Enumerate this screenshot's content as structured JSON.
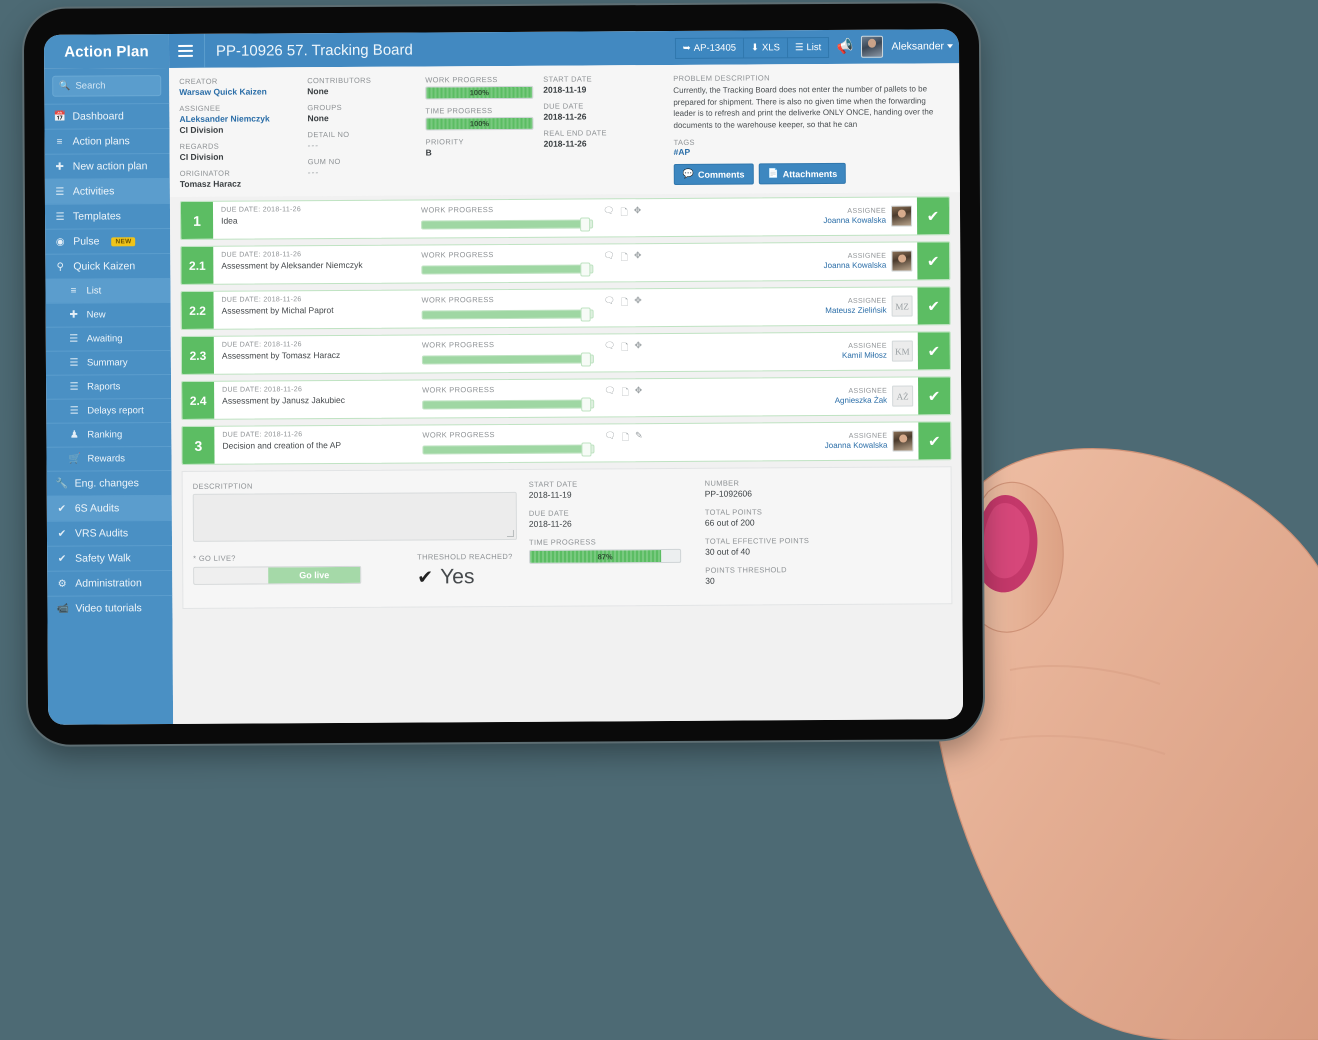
{
  "app": {
    "brand": "Action Plan",
    "page_title": "PP-10926 57. Tracking Board",
    "hamburger_icon": "hamburger-menu-icon"
  },
  "topbar": {
    "buttons": [
      {
        "label": "AP-13405",
        "icon": "external-link-icon"
      },
      {
        "label": "XLS",
        "icon": "download-icon"
      },
      {
        "label": "List",
        "icon": "list-icon"
      }
    ],
    "megaphone_icon": "megaphone-icon",
    "user": "Aleksander"
  },
  "sidebar": {
    "search_placeholder": "Search",
    "search_value": "",
    "items": [
      {
        "label": "Dashboard",
        "icon": "calendar-icon",
        "active": false,
        "sub": false
      },
      {
        "label": "Action plans",
        "icon": "board-icon",
        "active": false,
        "sub": false
      },
      {
        "label": "New action plan",
        "icon": "plus-icon",
        "active": false,
        "sub": false
      },
      {
        "label": "Activities",
        "icon": "sliders-icon",
        "active": true,
        "sub": false
      },
      {
        "label": "Templates",
        "icon": "list-icon",
        "active": false,
        "sub": false
      },
      {
        "label": "Pulse",
        "icon": "circle-icon",
        "active": false,
        "sub": false,
        "badge": "NEW"
      },
      {
        "label": "Quick Kaizen",
        "icon": "bulb-icon",
        "active": false,
        "sub": false
      },
      {
        "label": "List",
        "icon": "board-icon",
        "active": true,
        "sub": true
      },
      {
        "label": "New",
        "icon": "plus-icon",
        "active": false,
        "sub": true
      },
      {
        "label": "Awaiting",
        "icon": "list-icon",
        "active": false,
        "sub": true
      },
      {
        "label": "Summary",
        "icon": "list-icon",
        "active": false,
        "sub": true
      },
      {
        "label": "Raports",
        "icon": "list-icon",
        "active": false,
        "sub": true
      },
      {
        "label": "Delays report",
        "icon": "list-icon",
        "active": false,
        "sub": true
      },
      {
        "label": "Ranking",
        "icon": "trophy-icon",
        "active": false,
        "sub": true
      },
      {
        "label": "Rewards",
        "icon": "cart-icon",
        "active": false,
        "sub": true
      },
      {
        "label": "Eng. changes",
        "icon": "wrench-icon",
        "active": false,
        "sub": false
      },
      {
        "label": "6S Audits",
        "icon": "check-icon",
        "active": true,
        "sub": false
      },
      {
        "label": "VRS Audits",
        "icon": "check-icon",
        "active": false,
        "sub": false
      },
      {
        "label": "Safety Walk",
        "icon": "check-icon",
        "active": false,
        "sub": false
      },
      {
        "label": "Administration",
        "icon": "gear-icon",
        "active": false,
        "sub": false
      },
      {
        "label": "Video tutorials",
        "icon": "video-icon",
        "active": false,
        "sub": false
      }
    ]
  },
  "info": {
    "col1": [
      {
        "label": "CREATOR",
        "value": "Warsaw Quick Kaizen",
        "style": "link"
      },
      {
        "label": "ASSIGNEE",
        "value": "ALeksander Niemczyk",
        "style": "link",
        "sub": "CI Division"
      },
      {
        "label": "REGARDS",
        "value": "CI Division",
        "style": "bold"
      },
      {
        "label": "ORIGINATOR",
        "value": "Tomasz Haracz",
        "style": "bold"
      }
    ],
    "col2": [
      {
        "label": "CONTRIBUTORS",
        "value": "None",
        "style": "bold"
      },
      {
        "label": "GROUPS",
        "value": "None",
        "style": "bold"
      },
      {
        "label": "DETAIL NO",
        "value": "---",
        "style": "muted"
      },
      {
        "label": "GUM NO",
        "value": "---",
        "style": "muted"
      }
    ],
    "col3": [
      {
        "label": "WORK PROGRESS",
        "type": "bar",
        "value": 100,
        "text": "100%"
      },
      {
        "label": "TIME PROGRESS",
        "type": "bar",
        "value": 100,
        "text": "100%"
      },
      {
        "label": "PRIORITY",
        "type": "text",
        "value": "B"
      }
    ],
    "col4": [
      {
        "label": "START DATE",
        "value": "2018-11-19"
      },
      {
        "label": "DUE DATE",
        "value": "2018-11-26"
      },
      {
        "label": "REAL END DATE",
        "value": "2018-11-26"
      }
    ],
    "problem": {
      "label": "PROBLEM DESCRIPTION",
      "text": "Currently, the Tracking Board does not enter the number of pallets to be prepared for shipment. There is also no given time when the forwarding leader is to refresh and print the deliverke ONLY ONCE, handing over the documents to the warehouse keeper, so that he can",
      "tags_label": "TAGS",
      "tags": "#AP",
      "buttons": [
        {
          "label": "Comments",
          "icon": "comment-icon"
        },
        {
          "label": "Attachments",
          "icon": "file-icon"
        }
      ]
    }
  },
  "tasks": {
    "due_label": "DUE DATE:",
    "progress_label": "WORK PROGRESS",
    "assignee_label": "ASSIGNEE",
    "rows": [
      {
        "num": "1",
        "due": "2018-11-26",
        "name": "Idea",
        "progress": 96,
        "assignee": "Joanna Kowalska",
        "initials": "JK",
        "photo": true,
        "icons": [
          "comment-icon",
          "file-icon",
          "expand-icon"
        ]
      },
      {
        "num": "2.1",
        "due": "2018-11-26",
        "name": "Assessment by Aleksander Niemczyk",
        "progress": 96,
        "assignee": "Joanna Kowalska",
        "initials": "JK",
        "photo": true,
        "icons": [
          "comment-icon",
          "file-icon",
          "expand-icon"
        ]
      },
      {
        "num": "2.2",
        "due": "2018-11-26",
        "name": "Assessment by Michal Paprot",
        "progress": 96,
        "assignee": "Mateusz Zielińsik",
        "initials": "MZ",
        "photo": false,
        "icons": [
          "comment-icon",
          "file-icon",
          "expand-icon"
        ]
      },
      {
        "num": "2.3",
        "due": "2018-11-26",
        "name": "Assessment by Tomasz Haracz",
        "progress": 96,
        "assignee": "Kamil Miłosz",
        "initials": "KM",
        "photo": false,
        "icons": [
          "comment-icon",
          "file-icon",
          "expand-icon"
        ]
      },
      {
        "num": "2.4",
        "due": "2018-11-26",
        "name": "Assessment by Janusz Jakubiec",
        "progress": 96,
        "assignee": "Agnieszka Żak",
        "initials": "AŻ",
        "photo": false,
        "icons": [
          "comment-icon",
          "file-icon",
          "expand-icon"
        ]
      },
      {
        "num": "3",
        "due": "2018-11-26",
        "name": "Decision and creation of the AP",
        "progress": 96,
        "assignee": "Joanna Kowalska",
        "initials": "JK",
        "photo": true,
        "icons": [
          "comment-icon",
          "file-icon",
          "pin-icon"
        ]
      }
    ]
  },
  "detail": {
    "description_label": "DESCRITPTION",
    "description_value": "",
    "go_live_label": "* GO LIVE?",
    "go_live_button": "Go live",
    "threshold_label": "THRESHOLD REACHED?",
    "threshold_value": "Yes",
    "start_date_label": "START DATE",
    "start_date_value": "2018-11-19",
    "due_date_label": "DUE DATE",
    "due_date_value": "2018-11-26",
    "time_progress_label": "TIME PROGRESS",
    "time_progress_value": 87,
    "time_progress_text": "87%",
    "number_label": "NUMBER",
    "number_value": "PP-1092606",
    "total_points_label": "TOTAL POINTS",
    "total_points_value": "66 out of 200",
    "effective_points_label": "TOTAL EFFECTIVE POINTS",
    "effective_points_value": "30 out of 40",
    "points_threshold_label": "POINTS THRESHOLD",
    "points_threshold_value": "30"
  },
  "colors": {
    "brand_blue": "#4a90c4",
    "header_blue": "#4289c1",
    "green": "#5cbd63",
    "link_blue": "#2b6ea8",
    "page_bg": "#4d6a74"
  }
}
